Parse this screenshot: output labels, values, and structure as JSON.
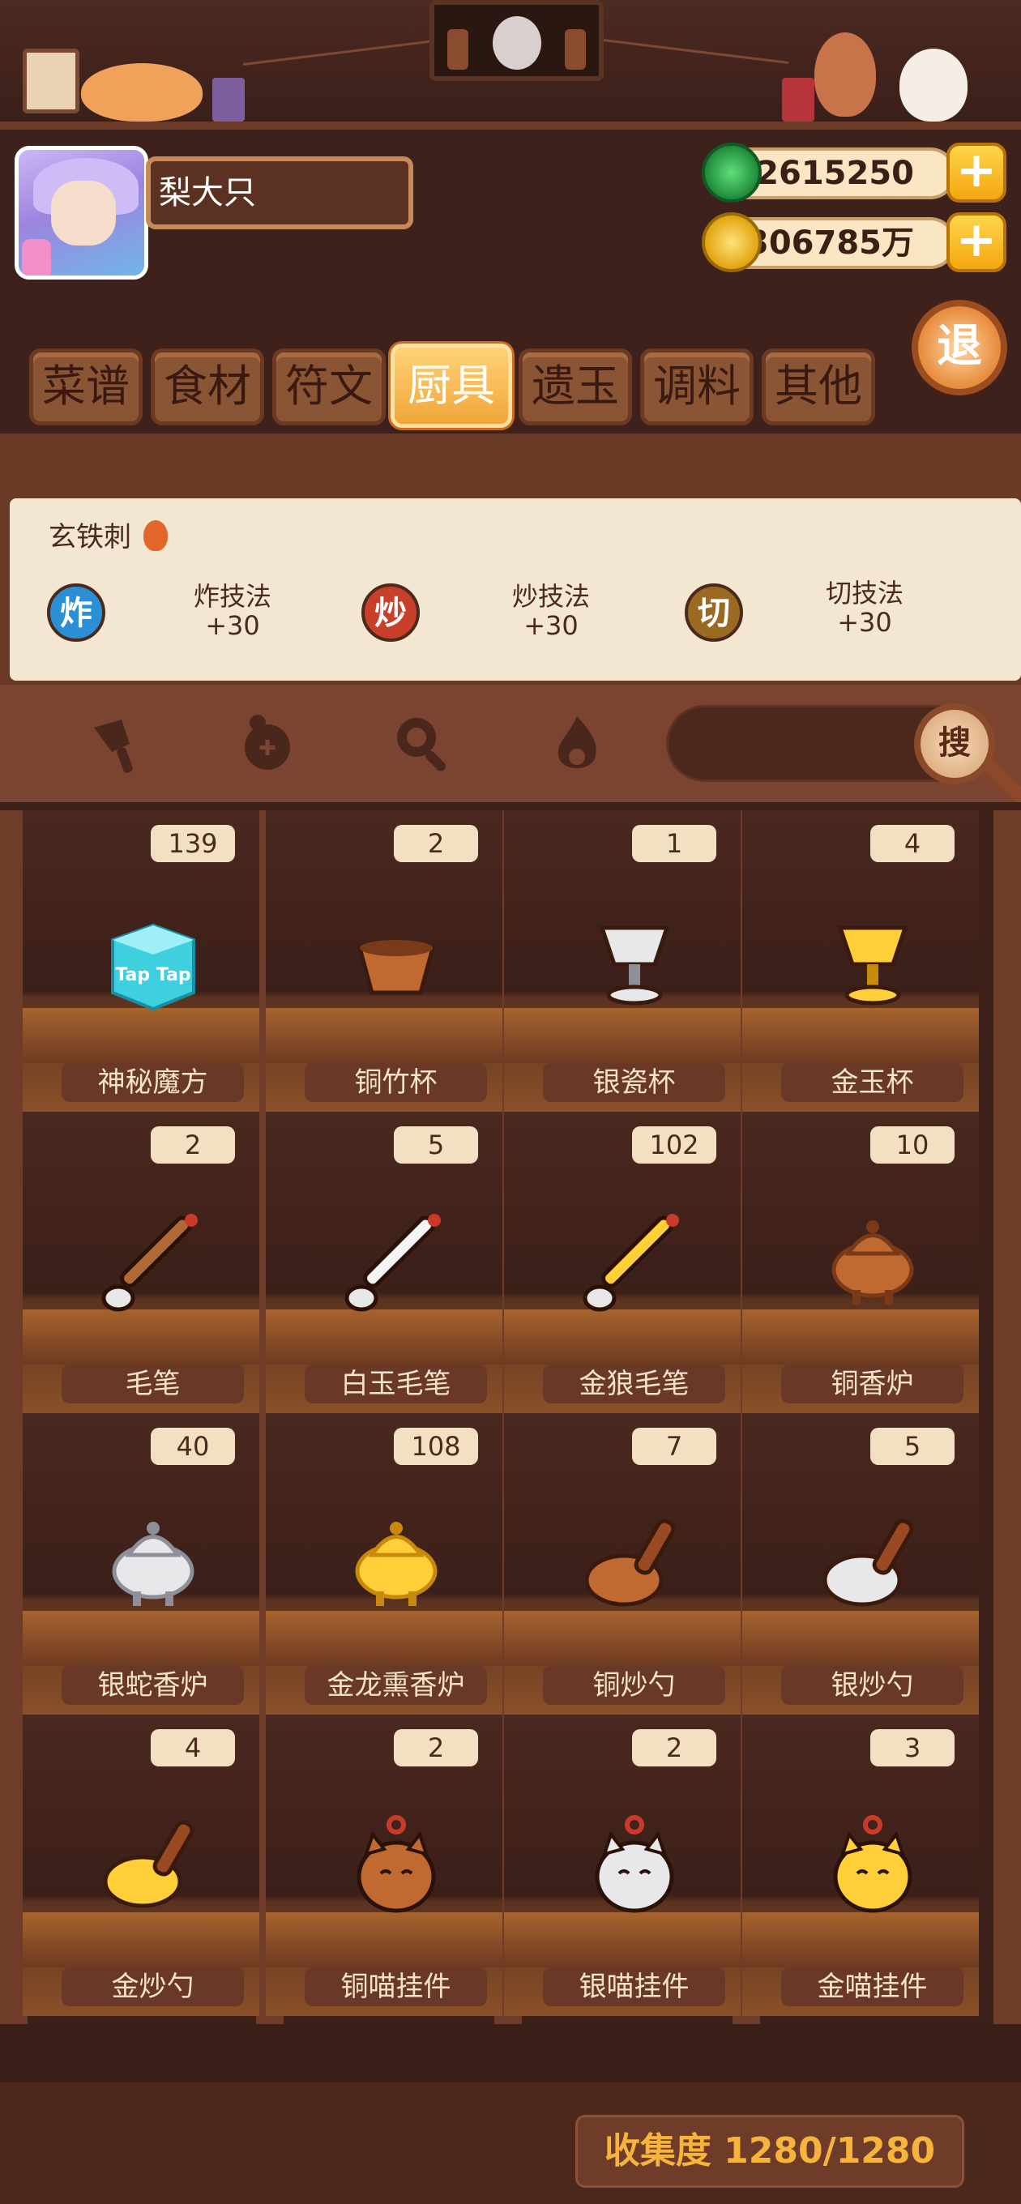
{
  "player": {
    "name": "梨大只"
  },
  "currency": {
    "jade": "2615250",
    "coins": "306785万"
  },
  "exit_label": "退",
  "tabs": [
    "菜谱",
    "食材",
    "符文",
    "厨具",
    "遗玉",
    "调料",
    "其他"
  ],
  "active_tab": "厨具",
  "selected_item": {
    "name": "玄铁刺",
    "skills": [
      {
        "icon": "炸",
        "name": "炸技法",
        "bonus": "+30",
        "color": "#2a8fd4"
      },
      {
        "icon": "炒",
        "name": "炒技法",
        "bonus": "+30",
        "color": "#c9402a"
      },
      {
        "icon": "切",
        "name": "切技法",
        "bonus": "+30",
        "color": "#9a6a22"
      }
    ]
  },
  "filters": [
    "knife-filter-icon",
    "pot-lid-filter-icon",
    "pan-filter-icon",
    "flame-filter-icon"
  ],
  "search_label": "搜",
  "items": [
    {
      "name": "神秘魔方",
      "count": "139",
      "art": "cube",
      "art_text": "Tap Tap"
    },
    {
      "name": "铜竹杯",
      "count": "2",
      "art": "bowl"
    },
    {
      "name": "银瓷杯",
      "count": "1",
      "art": "goblet-silver"
    },
    {
      "name": "金玉杯",
      "count": "4",
      "art": "goblet-gold"
    },
    {
      "name": "毛笔",
      "count": "2",
      "art": "brush-brown"
    },
    {
      "name": "白玉毛笔",
      "count": "5",
      "art": "brush-white"
    },
    {
      "name": "金狼毛笔",
      "count": "102",
      "art": "brush-gold"
    },
    {
      "name": "铜香炉",
      "count": "10",
      "art": "censer-bronze"
    },
    {
      "name": "银蛇香炉",
      "count": "40",
      "art": "censer-silver"
    },
    {
      "name": "金龙熏香炉",
      "count": "108",
      "art": "censer-gold"
    },
    {
      "name": "铜炒勺",
      "count": "7",
      "art": "ladle-bronze"
    },
    {
      "name": "银炒勺",
      "count": "5",
      "art": "ladle-silver"
    },
    {
      "name": "金炒勺",
      "count": "4",
      "art": "ladle-gold"
    },
    {
      "name": "铜喵挂件",
      "count": "2",
      "art": "cat-bronze"
    },
    {
      "name": "银喵挂件",
      "count": "2",
      "art": "cat-silver"
    },
    {
      "name": "金喵挂件",
      "count": "3",
      "art": "cat-gold"
    }
  ],
  "collection": "收集度 1280/1280",
  "colors": {
    "accent": "#f0a63a",
    "wood": "#6e3c28",
    "panel": "#f4e7d2"
  }
}
